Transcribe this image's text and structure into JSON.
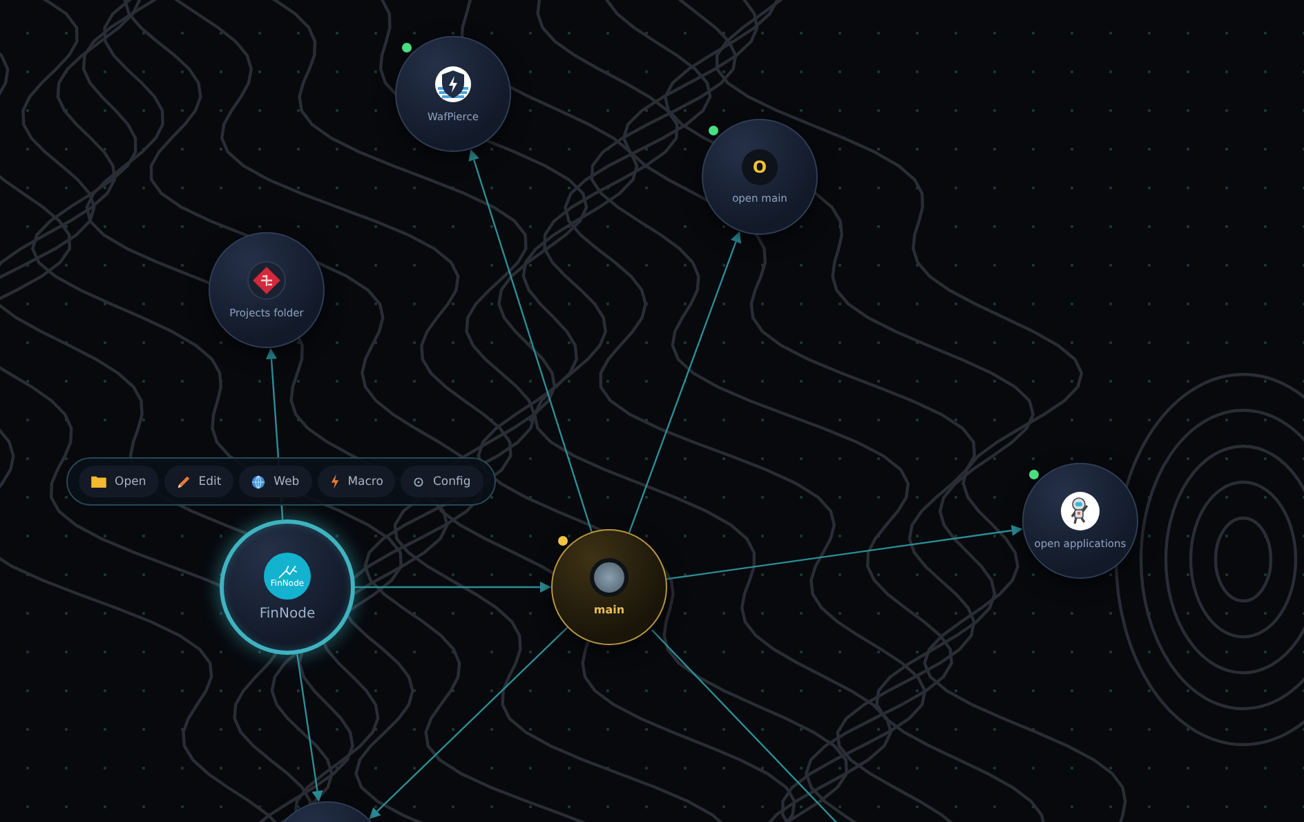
{
  "nodes": [
    {
      "label": "WafPierce",
      "kind": "app",
      "selected": false,
      "color": "#4ade80"
    },
    {
      "label": "open main",
      "kind": "app",
      "selected": false,
      "color": "#4ade80",
      "initial": "O"
    },
    {
      "label": "Projects folder",
      "kind": "app",
      "selected": false
    },
    {
      "label": "FinNode",
      "kind": "app",
      "selected": true,
      "logo_text": "FinNode"
    },
    {
      "label": "main",
      "kind": "hub",
      "selected": false,
      "color": "#f5c542"
    },
    {
      "label": "open applications",
      "kind": "app",
      "selected": false,
      "color": "#4ade80"
    },
    {
      "kind": "app",
      "selected": false
    }
  ],
  "toolbar": [
    {
      "label": "Open"
    },
    {
      "label": "Edit"
    },
    {
      "label": "Web"
    },
    {
      "label": "Macro"
    },
    {
      "label": "Config"
    }
  ]
}
